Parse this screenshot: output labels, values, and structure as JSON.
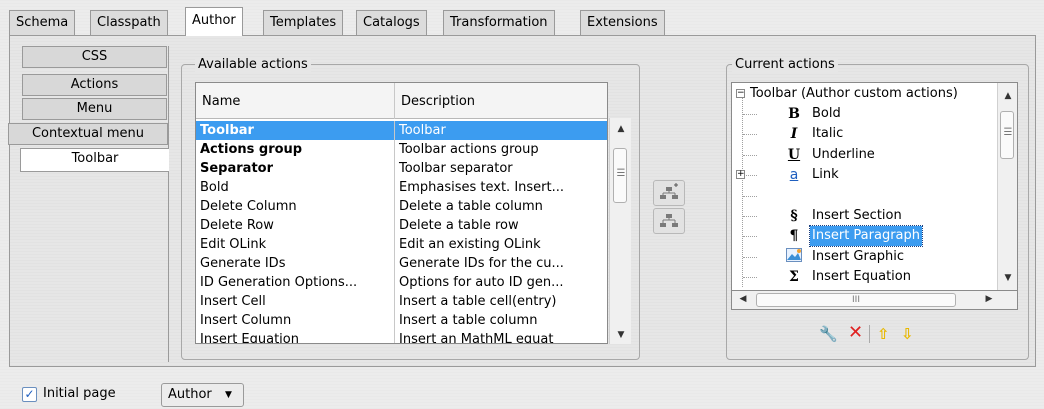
{
  "top_tabs": [
    {
      "label": "Schema"
    },
    {
      "label": "Classpath"
    },
    {
      "label": "Author",
      "active": true
    },
    {
      "label": "Templates"
    },
    {
      "label": "Catalogs"
    },
    {
      "label": "Transformation"
    },
    {
      "label": "Extensions"
    }
  ],
  "side_tabs": [
    {
      "label": "CSS"
    },
    {
      "label": "Actions"
    },
    {
      "label": "Menu"
    },
    {
      "label": "Contextual menu"
    },
    {
      "label": "Toolbar",
      "active": true
    }
  ],
  "available": {
    "title": "Available actions",
    "columns": [
      "Name",
      "Description"
    ],
    "rows": [
      {
        "name": "Toolbar",
        "desc": "Toolbar",
        "bold": true,
        "selected": true
      },
      {
        "name": "Actions group",
        "desc": "Toolbar actions group",
        "bold": true
      },
      {
        "name": "Separator",
        "desc": "Toolbar separator",
        "bold": true
      },
      {
        "name": "Bold",
        "desc": "Emphasises text. Insert..."
      },
      {
        "name": "Delete Column",
        "desc": "Delete a table column"
      },
      {
        "name": "Delete Row",
        "desc": "Delete a table row"
      },
      {
        "name": "Edit OLink",
        "desc": "Edit an existing OLink"
      },
      {
        "name": "Generate IDs",
        "desc": "Generate IDs for the cu..."
      },
      {
        "name": "ID Generation Options...",
        "desc": "Options for auto ID gen..."
      },
      {
        "name": "Insert Cell",
        "desc": "Insert a table cell(entry)"
      },
      {
        "name": "Insert Column",
        "desc": "Insert a table column"
      },
      {
        "name": "Insert Equation",
        "desc": "Insert an MathML equat"
      }
    ]
  },
  "middle_buttons": {
    "add": "add-action-icon",
    "remove": "remove-action-icon"
  },
  "current": {
    "title": "Current actions",
    "root": "Toolbar (Author custom actions)",
    "items": [
      {
        "glyph": "B",
        "label": "Bold",
        "icon": "bold-icon"
      },
      {
        "glyph": "I",
        "label": "Italic",
        "icon": "italic-icon"
      },
      {
        "glyph": "U",
        "label": "Underline",
        "icon": "underline-icon"
      },
      {
        "glyph": "a",
        "label": "Link",
        "icon": "link-icon",
        "expandable": true
      },
      {
        "glyph": "",
        "label": "",
        "icon": "separator"
      },
      {
        "glyph": "§",
        "label": "Insert Section",
        "icon": "section-icon"
      },
      {
        "glyph": "¶",
        "label": "Insert Paragraph",
        "icon": "paragraph-icon",
        "selected": true
      },
      {
        "glyph": "",
        "label": "Insert Graphic",
        "icon": "graphic-icon"
      },
      {
        "glyph": "Σ",
        "label": "Insert Equation",
        "icon": "equation-icon"
      }
    ],
    "hscroll_mid": "III"
  },
  "bottom": {
    "checkbox_label": "Initial page",
    "checked": true,
    "combo_value": "Author"
  },
  "colors": {
    "selection": "#3c9cf0",
    "delete": "#e02020",
    "arrows": "#e8b800"
  }
}
